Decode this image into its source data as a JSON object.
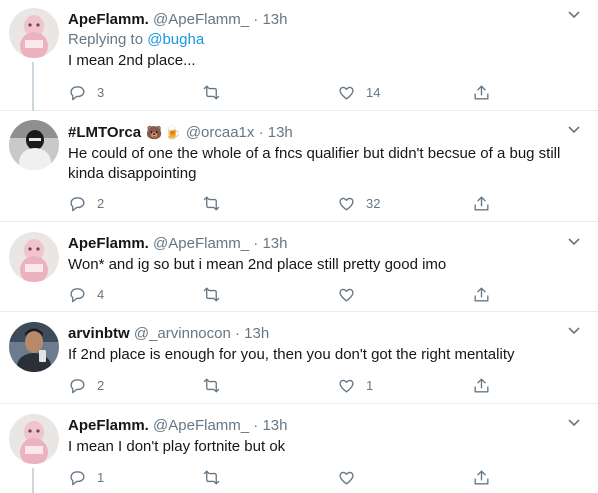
{
  "tweets": [
    {
      "name": "ApeFlamm.",
      "handle": "@ApeFlamm_",
      "dot": "·",
      "time": "13h",
      "replying_prefix": "Replying to",
      "replying_to": "@bugha",
      "text": "I mean 2nd place...",
      "replies": "3",
      "retweets": "",
      "likes": "14",
      "avatar": "pink-figure"
    },
    {
      "name": "#LMTOrca",
      "emoji1": "🐻",
      "emoji2": "🍺",
      "handle": "@orcaa1x",
      "dot": "·",
      "time": "13h",
      "text": "He could of one the whole of a fncs qualifier but didn't becsue of a bug still kinda disappointing",
      "replies": "2",
      "retweets": "",
      "likes": "32",
      "avatar": "masked-figure"
    },
    {
      "name": "ApeFlamm.",
      "handle": "@ApeFlamm_",
      "dot": "·",
      "time": "13h",
      "text": "Won* and ig so but i mean 2nd place still pretty good imo",
      "replies": "4",
      "retweets": "",
      "likes": "",
      "avatar": "pink-figure"
    },
    {
      "name": "arvinbtw",
      "handle": "@_arvinnocon",
      "dot": "·",
      "time": "13h",
      "text": "If 2nd place is enough for you, then you don't got the right mentality",
      "replies": "2",
      "retweets": "",
      "likes": "1",
      "avatar": "person-photo"
    },
    {
      "name": "ApeFlamm.",
      "handle": "@ApeFlamm_",
      "dot": "·",
      "time": "13h",
      "text": "I mean I don't play fortnite but ok",
      "replies": "1",
      "retweets": "",
      "likes": "",
      "avatar": "pink-figure"
    }
  ],
  "colors": {
    "text": "#14171a",
    "secondary": "#657786",
    "link": "#1b95e0",
    "divider": "#e6ecf0",
    "thread_line": "#ccd6dd"
  },
  "icons": {
    "reply": "reply-icon",
    "retweet": "retweet-icon",
    "like": "heart-icon",
    "share": "share-icon",
    "more": "chevron-down-icon"
  }
}
